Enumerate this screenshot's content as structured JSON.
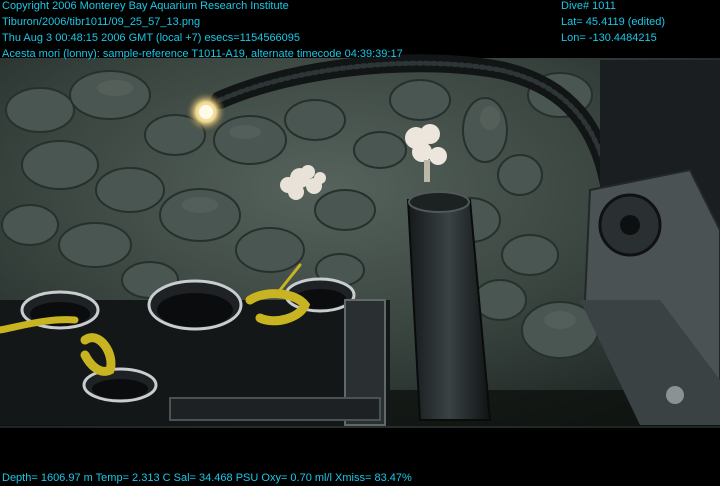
{
  "overlay": {
    "top_left": [
      "Copyright 2006 Monterey Bay Aquarium Research Institute",
      "Tiburon/2006/tibr1011/09_25_57_13.png",
      "Thu Aug  3 00:48:15 2006 GMT (local +7)  esecs=1154566095",
      "Acesta mori (lonny): sample-reference T1011-A19, alternate timecode 04:39:39:17"
    ],
    "top_right": [
      "Dive# 1011",
      "Lat= 45.4119 (edited)",
      "Lon= -130.4484215"
    ],
    "bottom": "Depth= 1606.97 m  Temp= 2.313 C  Sal= 34.468 PSU  Oxy= 0.70 ml/l  Xmiss= 83.47%"
  },
  "colors": {
    "overlay_text": "#19c8e6",
    "seafloor": "#3a4642",
    "sponge": "#e8e2d8",
    "rope": "#c8b420"
  }
}
